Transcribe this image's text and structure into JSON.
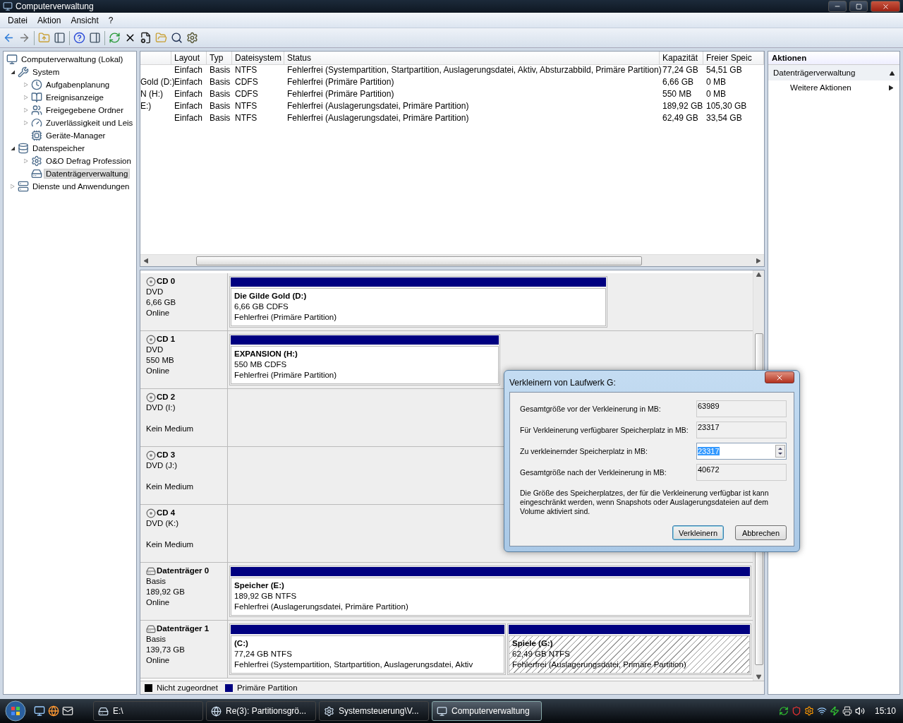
{
  "window": {
    "title": "Computerverwaltung"
  },
  "menu": [
    "Datei",
    "Aktion",
    "Ansicht",
    "?"
  ],
  "tree": [
    {
      "label": "Computerverwaltung (Lokal)",
      "selected": false,
      "children": [
        {
          "label": "System",
          "expanded": true,
          "selected": false,
          "children": [
            {
              "label": "Aufgabenplanung",
              "expanded": false,
              "selected": false
            },
            {
              "label": "Ereignisanzeige",
              "expanded": false,
              "selected": false
            },
            {
              "label": "Freigegebene Ordner",
              "expanded": false,
              "selected": false
            },
            {
              "label": "Zuverlässigkeit und Leis",
              "expanded": false,
              "selected": false
            },
            {
              "label": "Geräte-Manager",
              "selected": false
            }
          ]
        },
        {
          "label": "Datenspeicher",
          "expanded": true,
          "selected": false,
          "children": [
            {
              "label": "O&O Defrag Profession",
              "expanded": false,
              "selected": false
            },
            {
              "label": "Datenträgerverwaltung",
              "selected": true
            }
          ]
        },
        {
          "label": "Dienste und Anwendungen",
          "expanded": false,
          "selected": false
        }
      ]
    }
  ],
  "table": {
    "columns": [
      "",
      "Layout",
      "Typ",
      "Dateisystem",
      "Status",
      "Kapazität",
      "Freier Speic"
    ],
    "rows": [
      [
        "",
        "Einfach",
        "Basis",
        "NTFS",
        "Fehlerfrei (Systempartition, Startpartition, Auslagerungsdatei, Aktiv, Absturzabbild, Primäre Partition)",
        "77,24 GB",
        "54,51 GB"
      ],
      [
        "Gold (D:)",
        "Einfach",
        "Basis",
        "CDFS",
        "Fehlerfrei (Primäre Partition)",
        "6,66 GB",
        "0 MB"
      ],
      [
        "N (H:)",
        "Einfach",
        "Basis",
        "CDFS",
        "Fehlerfrei (Primäre Partition)",
        "550 MB",
        "0 MB"
      ],
      [
        "E:)",
        "Einfach",
        "Basis",
        "NTFS",
        "Fehlerfrei (Auslagerungsdatei, Primäre Partition)",
        "189,92 GB",
        "105,30 GB"
      ],
      [
        "",
        "Einfach",
        "Basis",
        "NTFS",
        "Fehlerfrei (Auslagerungsdatei, Primäre Partition)",
        "62,49 GB",
        "33,54 GB"
      ]
    ]
  },
  "disks": [
    {
      "kind": "cd",
      "name": "CD 0",
      "type": "DVD",
      "size": "6,66 GB",
      "status": "Online",
      "partitions": [
        {
          "name": "Die Gilde Gold  (D:)",
          "size": "6,66 GB CDFS",
          "status": "Fehlerfrei (Primäre Partition)",
          "selected": false
        }
      ]
    },
    {
      "kind": "cd",
      "name": "CD 1",
      "type": "DVD",
      "size": "550 MB",
      "status": "Online",
      "partitions": [
        {
          "name": "EXPANSION  (H:)",
          "size": "550 MB CDFS",
          "status": "Fehlerfrei (Primäre Partition)",
          "selected": false
        }
      ]
    },
    {
      "kind": "cd",
      "name": "CD 2",
      "type": "DVD (I:)",
      "status": "Kein Medium"
    },
    {
      "kind": "cd",
      "name": "CD 3",
      "type": "DVD (J:)",
      "status": "Kein Medium"
    },
    {
      "kind": "cd",
      "name": "CD 4",
      "type": "DVD (K:)",
      "status": "Kein Medium"
    },
    {
      "kind": "hdd",
      "name": "Datenträger 0",
      "type": "Basis",
      "size": "189,92 GB",
      "status": "Online",
      "partitions": [
        {
          "name": "Speicher  (E:)",
          "size": "189,92 GB NTFS",
          "status": "Fehlerfrei (Auslagerungsdatei, Primäre Partition)",
          "selected": false
        }
      ]
    },
    {
      "kind": "hdd",
      "name": "Datenträger 1",
      "type": "Basis",
      "size": "139,73 GB",
      "status": "Online",
      "partitions": [
        {
          "name": " (C:)",
          "size": "77,24 GB NTFS",
          "status": "Fehlerfrei (Systempartition, Startpartition, Auslagerungsdatei, Aktiv",
          "selected": false
        },
        {
          "name": "Spiele  (G:)",
          "size": "62,49 GB NTFS",
          "status": "Fehlerfrei (Auslagerungsdatei, Primäre Partition)",
          "selected": true
        }
      ]
    }
  ],
  "legend": [
    {
      "label": "Nicht zugeordnet",
      "color": "#000000"
    },
    {
      "label": "Primäre Partition",
      "color": "#000080"
    }
  ],
  "actions": {
    "title": "Aktionen",
    "section": "Datenträgerverwaltung",
    "items": [
      "Weitere Aktionen"
    ]
  },
  "dialog": {
    "title": "Verkleinern von Laufwerk G:",
    "fields": [
      {
        "label": "Gesamtgröße vor der Verkleinerung in MB:",
        "value": "63989",
        "kind": "readonly"
      },
      {
        "label": "Für Verkleinerung verfügbarer Speicherplatz in MB:",
        "value": "23317",
        "kind": "readonly"
      },
      {
        "label": "Zu verkleinernder Speicherplatz in MB:",
        "value": "23317",
        "kind": "spin"
      },
      {
        "label": "Gesamtgröße nach der Verkleinerung in MB:",
        "value": "40672",
        "kind": "readonly"
      }
    ],
    "note": "Die Größe des Speicherplatzes, der für die Verkleinerung verfügbar ist kann eingeschränkt werden, wenn Snapshots oder Auslagerungsdateien auf dem Volume aktiviert sind.",
    "buttons": [
      {
        "label": "Verkleinern",
        "default": true
      },
      {
        "label": "Abbrechen",
        "default": false
      }
    ]
  },
  "taskbar": {
    "tasks": [
      {
        "label": "E:\\",
        "selected": false
      },
      {
        "label": "Re(3): Partitionsgrö...",
        "selected": false
      },
      {
        "label": "Systemsteuerung\\V...",
        "selected": false
      },
      {
        "label": "Computerverwaltung",
        "selected": true
      }
    ],
    "clock": "15:10"
  }
}
